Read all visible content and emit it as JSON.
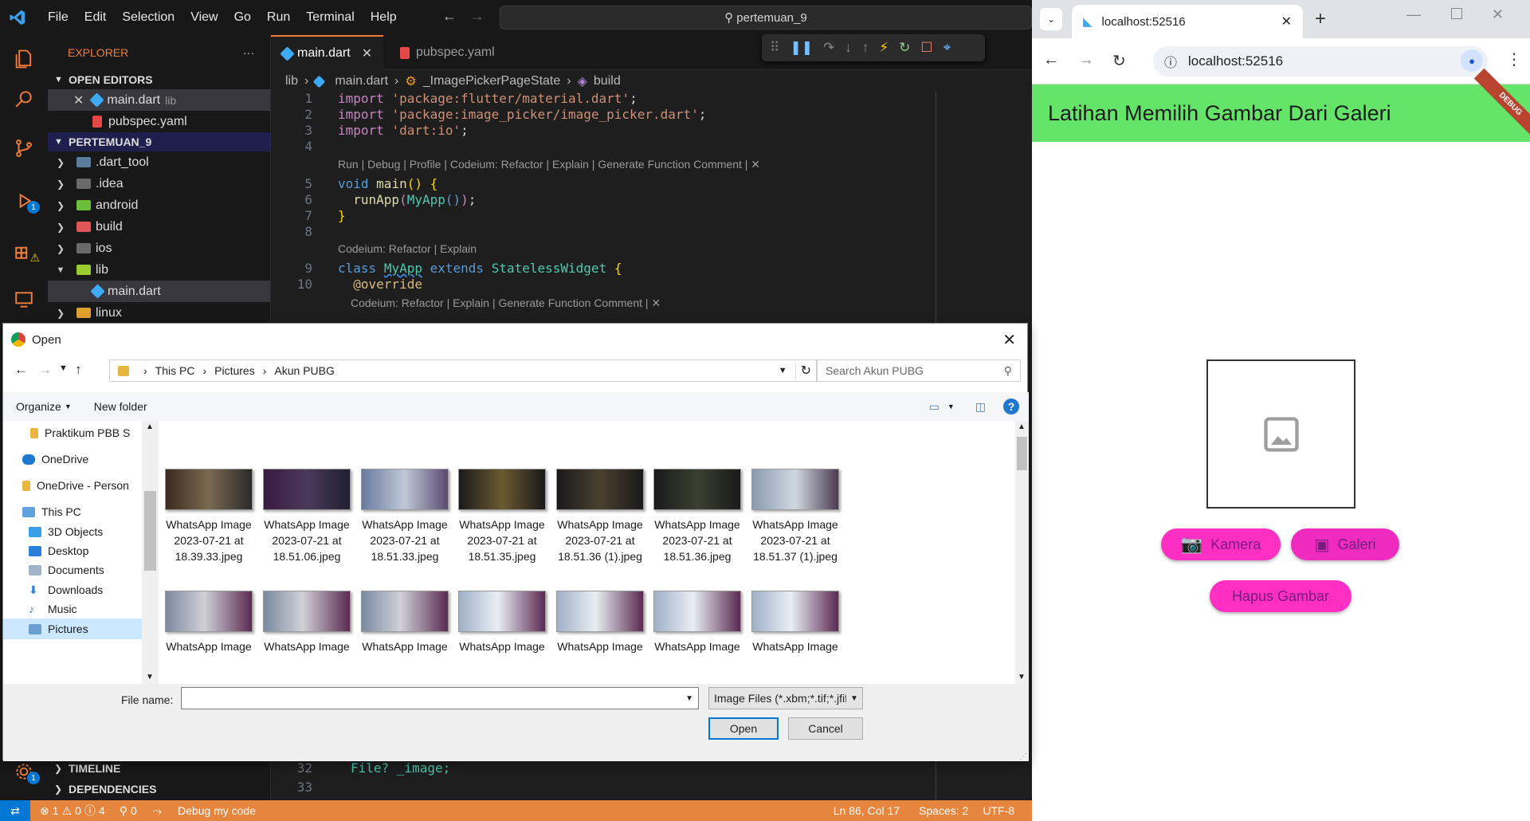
{
  "vscode": {
    "menu": [
      "File",
      "Edit",
      "Selection",
      "View",
      "Go",
      "Run",
      "Terminal",
      "Help"
    ],
    "command_center": "pertemuan_9",
    "explorer_title": "EXPLORER",
    "open_editors_title": "OPEN EDITORS",
    "open_editors": [
      {
        "name": "main.dart",
        "hint": "lib"
      },
      {
        "name": "pubspec.yaml"
      }
    ],
    "project_title": "PERTEMUAN_9",
    "tree": [
      ".dart_tool",
      ".idea",
      "android",
      "build",
      "ios",
      "lib",
      "main.dart",
      "linux"
    ],
    "timeline": "TIMELINE",
    "dependencies": "DEPENDENCIES",
    "tabs": [
      "main.dart",
      "pubspec.yaml"
    ],
    "breadcrumb": [
      "lib",
      "main.dart",
      "_ImagePickerPageState",
      "build"
    ],
    "code_lens_1": "Run | Debug | Profile | Codeium: Refactor | Explain | Generate Function Comment | ✕",
    "code_lens_2": "Codeium: Refactor | Explain",
    "code_lens_3": "Codeium: Refactor | Explain | Generate Function Comment | ✕",
    "line_numbers": [
      "1",
      "2",
      "3",
      "4",
      "5",
      "6",
      "7",
      "8",
      "9",
      "10"
    ],
    "line_numbers_bottom": [
      "32",
      "33"
    ],
    "code_tail": "File? _image;",
    "status": {
      "errors": "1",
      "warnings": "0",
      "infos": "4",
      "ports": "0",
      "debug": "Debug my code",
      "position": "Ln 86, Col 17",
      "spaces": "Spaces: 2",
      "encoding": "UTF-8"
    },
    "badges": {
      "debug": "1",
      "settings": "1"
    }
  },
  "chrome": {
    "tab_title": "localhost:52516",
    "url": "localhost:52516",
    "app_title": "Latihan Memilih Gambar Dari Galeri",
    "debug_banner": "DEBUG",
    "buttons": {
      "camera": "Kamera",
      "gallery": "Galeri",
      "delete": "Hapus Gambar"
    }
  },
  "dialog": {
    "title": "Open",
    "path": [
      "This PC",
      "Pictures",
      "Akun PUBG"
    ],
    "search_placeholder": "Search Akun PUBG",
    "organize": "Organize",
    "new_folder": "New folder",
    "help": "?",
    "nav_tree": [
      "Praktikum PBB S",
      "OneDrive",
      "OneDrive - Person",
      "This PC",
      "3D Objects",
      "Desktop",
      "Documents",
      "Downloads",
      "Music",
      "Pictures"
    ],
    "files_row1": [
      {
        "l1": "WhatsApp Image",
        "l2": "2023-07-21 at",
        "l3": "18.39.33.jpeg"
      },
      {
        "l1": "WhatsApp Image",
        "l2": "2023-07-21 at",
        "l3": "18.51.06.jpeg"
      },
      {
        "l1": "WhatsApp Image",
        "l2": "2023-07-21 at",
        "l3": "18.51.33.jpeg"
      },
      {
        "l1": "WhatsApp Image",
        "l2": "2023-07-21 at",
        "l3": "18.51.35.jpeg"
      },
      {
        "l1": "WhatsApp Image",
        "l2": "2023-07-21 at",
        "l3": "18.51.36 (1).jpeg"
      },
      {
        "l1": "WhatsApp Image",
        "l2": "2023-07-21 at",
        "l3": "18.51.36.jpeg"
      },
      {
        "l1": "WhatsApp Image",
        "l2": "2023-07-21 at",
        "l3": "18.51.37 (1).jpeg"
      }
    ],
    "files_row2_label": "WhatsApp Image",
    "file_name_label": "File name:",
    "file_name_value": "",
    "file_type": "Image Files (*.xbm;*.tif;*.jfif;*.icc",
    "open_button": "Open",
    "cancel_button": "Cancel"
  }
}
